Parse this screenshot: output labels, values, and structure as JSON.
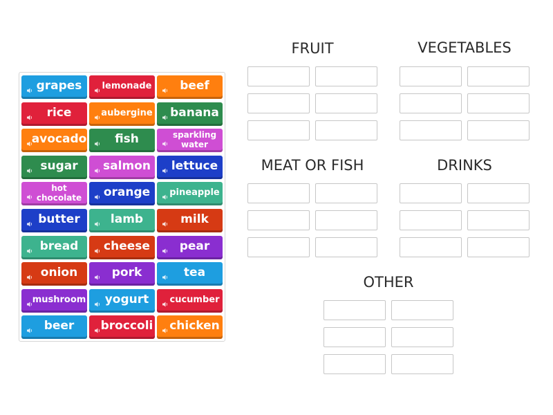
{
  "colors": {
    "blue": "#1e9ee0",
    "red": "#e0213b",
    "orange": "#ff7f0f",
    "green": "#2e8c4e",
    "pink": "#cf4ed4",
    "purple": "#8a2ed0",
    "darkblue": "#1d3fc8",
    "mint": "#3db38e",
    "crimson": "#d63a14"
  },
  "tiles": [
    {
      "label": "grapes",
      "color": "blue",
      "icon": "speaker-icon"
    },
    {
      "label": "lemonade",
      "color": "red",
      "icon": "speaker-icon"
    },
    {
      "label": "beef",
      "color": "orange",
      "icon": "speaker-icon"
    },
    {
      "label": "rice",
      "color": "red",
      "icon": "speaker-icon"
    },
    {
      "label": "aubergine",
      "color": "orange",
      "icon": "speaker-icon"
    },
    {
      "label": "banana",
      "color": "green",
      "icon": "speaker-icon"
    },
    {
      "label": "avocado",
      "color": "orange",
      "icon": "speaker-icon"
    },
    {
      "label": "fish",
      "color": "green",
      "icon": "speaker-icon"
    },
    {
      "label": "sparkling water",
      "color": "pink",
      "icon": "speaker-icon"
    },
    {
      "label": "sugar",
      "color": "green",
      "icon": "speaker-icon"
    },
    {
      "label": "salmon",
      "color": "pink",
      "icon": "speaker-icon"
    },
    {
      "label": "lettuce",
      "color": "darkblue",
      "icon": "speaker-icon"
    },
    {
      "label": "hot chocolate",
      "color": "pink",
      "icon": "speaker-icon"
    },
    {
      "label": "orange",
      "color": "darkblue",
      "icon": "speaker-icon"
    },
    {
      "label": "pineapple",
      "color": "mint",
      "icon": "speaker-icon"
    },
    {
      "label": "butter",
      "color": "darkblue",
      "icon": "speaker-icon"
    },
    {
      "label": "lamb",
      "color": "mint",
      "icon": "speaker-icon"
    },
    {
      "label": "milk",
      "color": "crimson",
      "icon": "speaker-icon"
    },
    {
      "label": "bread",
      "color": "mint",
      "icon": "speaker-icon"
    },
    {
      "label": "cheese",
      "color": "crimson",
      "icon": "speaker-icon"
    },
    {
      "label": "pear",
      "color": "purple",
      "icon": "speaker-icon"
    },
    {
      "label": "onion",
      "color": "crimson",
      "icon": "speaker-icon"
    },
    {
      "label": "pork",
      "color": "purple",
      "icon": "speaker-icon"
    },
    {
      "label": "tea",
      "color": "blue",
      "icon": "speaker-icon"
    },
    {
      "label": "mushroom",
      "color": "purple",
      "icon": "speaker-icon"
    },
    {
      "label": "yogurt",
      "color": "blue",
      "icon": "speaker-icon"
    },
    {
      "label": "cucumber",
      "color": "red",
      "icon": "speaker-icon"
    },
    {
      "label": "beer",
      "color": "blue",
      "icon": "speaker-icon"
    },
    {
      "label": "broccoli",
      "color": "red",
      "icon": "speaker-icon"
    },
    {
      "label": "chicken",
      "color": "orange",
      "icon": "speaker-icon"
    }
  ],
  "groups": {
    "fruit": "FRUIT",
    "vegetables": "VEGETABLES",
    "meat_or_fish": "MEAT OR FISH",
    "drinks": "DRINKS",
    "other": "OTHER"
  }
}
